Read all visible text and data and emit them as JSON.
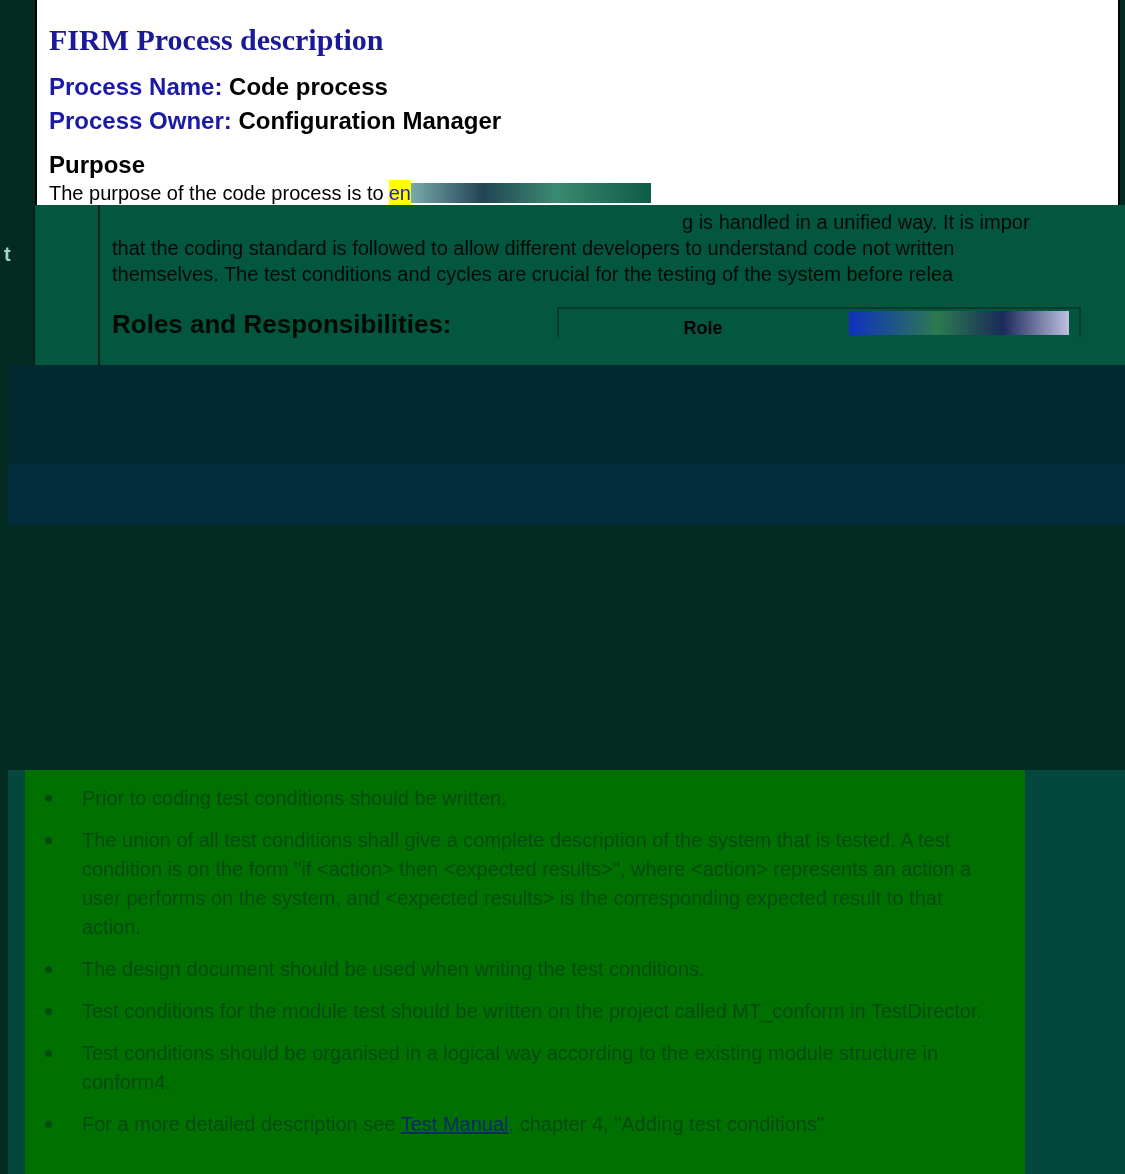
{
  "page_title": "FIRM Process description",
  "fields": [
    {
      "label": "Process Name:",
      "value": "Code process"
    },
    {
      "label": "Process Owner:",
      "value": "Configuration Manager"
    }
  ],
  "purpose": {
    "heading": "Purpose",
    "line_start": "The purpose of the code process is to",
    "highlighted": "en",
    "line_end": "g is handled in a unified way. It is impor",
    "lines": [
      "that the coding standard is followed to allow different developers to understand code not written",
      "themselves. The test conditions and cycles are crucial for the testing of the system before relea"
    ]
  },
  "margin_text": "t",
  "roles": {
    "heading": "Roles and Responsibilities:",
    "table_columns": [
      "Role"
    ]
  },
  "bullets": [
    {
      "text": "Prior to coding test conditions should be written."
    },
    {
      "text": "The union of all test conditions shall give a complete description of the system that is tested. A test condition is on the form \"if <action> then <expected results>\", where <action> represents an action a user performs on the system, and <expected results> is the corresponding expected result to that action."
    },
    {
      "text": "The design document should be used when writing the test conditions."
    },
    {
      "text": "Test conditions for the module test should be written on the project called MT_conform in TestDirector."
    },
    {
      "text": "Test conditions should be organised in a logical way according to the existing module structure in conform4."
    },
    {
      "text": "For a more detailed description see",
      "link": "Test Manual",
      "after": ", chapter 4, \"Adding test conditions\""
    }
  ]
}
